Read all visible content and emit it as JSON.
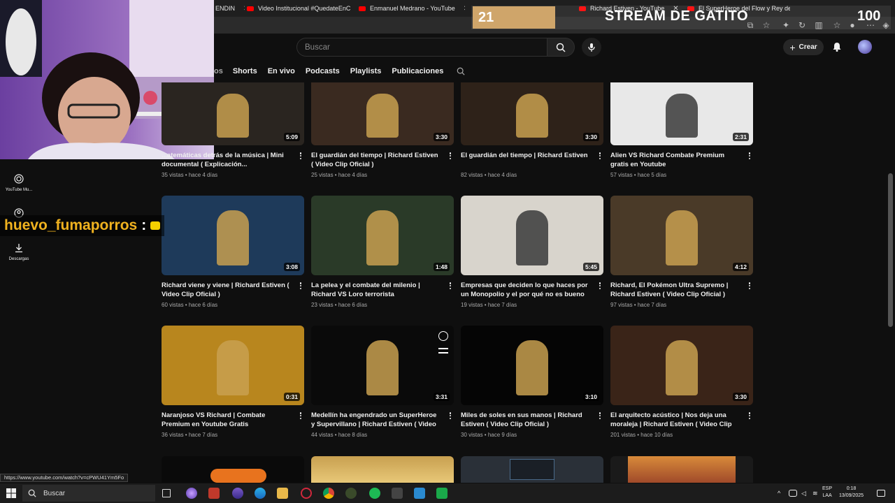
{
  "browser": {
    "tabs": [
      {
        "label": "ENDIN",
        "has_youtube_icon": false
      },
      {
        "label": "Video Institucional #QuedateEnC",
        "has_youtube_icon": true
      },
      {
        "label": "Enmanuel Medrano - YouTube",
        "has_youtube_icon": true
      },
      {
        "label": "Richard Estiven - YouTube",
        "has_youtube_icon": true
      },
      {
        "label": "El SuperHeroe del Flow y Rey de",
        "has_youtube_icon": true
      }
    ]
  },
  "overlay": {
    "count": "21",
    "title": "STREAM DE GATITO",
    "goal": "100"
  },
  "youtube": {
    "search": {
      "placeholder": "Buscar"
    },
    "create_label": "Crear",
    "channel_tabs": [
      "os",
      "Shorts",
      "En vivo",
      "Podcasts",
      "Playlists",
      "Publicaciones"
    ],
    "sidebar": [
      {
        "label": "YouTube Mu...",
        "icon": "youtube-music-icon"
      },
      {
        "label": "",
        "icon": "account-icon"
      },
      {
        "label": "Descargas",
        "icon": "download-icon"
      }
    ]
  },
  "chat": {
    "user": "huevo_fumaporros",
    "separator": ":"
  },
  "videos": [
    {
      "title": "...atemáticas detrás de la música | Mini documental ( Explicación...",
      "meta": "35 vistas • hace 4 días",
      "duration": "5:09",
      "bg": "#2a2520"
    },
    {
      "title": "El guardián del tiempo | Richard Estiven ( Video Clip Oficial )",
      "meta": "25 vistas • hace 4 días",
      "duration": "3:30",
      "bg": "#3a2a20"
    },
    {
      "title": "El guardián del tiempo | Richard Estiven",
      "meta": "82 vistas • hace 4 días",
      "duration": "3:30",
      "bg": "#2e2219"
    },
    {
      "title": "Alien VS Richard Combate Premium gratis en Youtube",
      "meta": "57 vistas • hace 5 días",
      "duration": "2:31",
      "bg": "#e8e8e8"
    },
    {
      "title": "Richard viene y viene | Richard Estiven ( Video Clip Oficial )",
      "meta": "60 vistas • hace 6 días",
      "duration": "3:08",
      "bg": "#1e3a5a"
    },
    {
      "title": "La pelea y el combate del milenio | Richard VS Loro terrorista",
      "meta": "23 vistas • hace 6 días",
      "duration": "1:48",
      "bg": "#2a3a28"
    },
    {
      "title": "Empresas que deciden lo que haces por un Monopolio y el por qué no es bueno en un...",
      "meta": "19 vistas • hace 7 días",
      "duration": "5:45",
      "bg": "#d8d4cc"
    },
    {
      "title": "Richard, El Pokémon Ultra Supremo | Richard Estiven ( Video Clip Oficial )",
      "meta": "97 vistas • hace 7 días",
      "duration": "4:12",
      "bg": "#4a3a28"
    },
    {
      "title": "Naranjoso VS Richard | Combate Premium en Youtube Gratis",
      "meta": "36 vistas • hace 7 días",
      "duration": "0:31",
      "bg": "#b8861e"
    },
    {
      "title": "Medellín ha engendrado un SuperHeroe y Supervillano | Richard Estiven ( Video Clip...",
      "meta": "44 vistas • hace 8 días",
      "duration": "3:31",
      "bg": "#0a0a0a"
    },
    {
      "title": "Miles de soles en sus manos | Richard Estiven ( Video Clip Oficial )",
      "meta": "30 vistas • hace 9 días",
      "duration": "3:10",
      "bg": "#050505"
    },
    {
      "title": "El arquitecto acústico | Nos deja una moraleja | Richard Estiven ( Video Clip Ofici...",
      "meta": "201 vistas • hace 10 días",
      "duration": "3:30",
      "bg": "#3a2418"
    }
  ],
  "status_url": "https://www.youtube.com/watch?v=cPWU41Ym5Fo",
  "taskbar": {
    "search_label": "Buscar",
    "lang_line1": "ESP",
    "lang_line2": "LAA",
    "time": "0:18",
    "date": "13/09/2025"
  },
  "colors": {
    "background": "#0f0f0f",
    "accent_youtube": "#ff0000",
    "chat_user": "#f0b21f",
    "overlay_count_bg": "#cfa56a"
  }
}
